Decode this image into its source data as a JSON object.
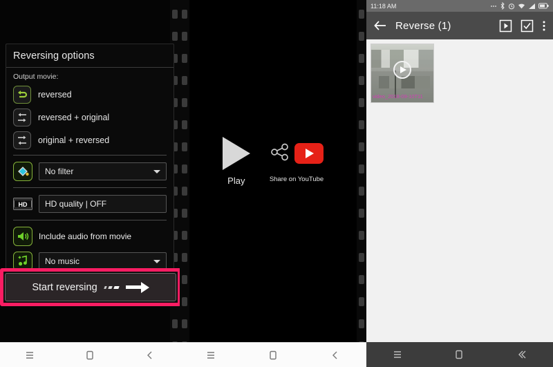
{
  "panel1": {
    "card_title": "Reversing options",
    "sub_label": "Output movie:",
    "options": [
      {
        "label": "reversed",
        "icon": "reverse-loop-icon",
        "selected": true
      },
      {
        "label": "reversed + original",
        "icon": "reverse-then-forward-icon",
        "selected": false
      },
      {
        "label": "original + reversed",
        "icon": "forward-then-reverse-icon",
        "selected": false
      }
    ],
    "filter": {
      "icon": "paint-bucket-icon",
      "value": "No filter"
    },
    "hd": {
      "icon": "hd-film-icon",
      "label": "HD quality | OFF"
    },
    "audio": {
      "icon": "speaker-icon",
      "label": "Include audio from movie"
    },
    "music": {
      "icon": "music-note-icon",
      "value": "No music"
    },
    "start_button": "Start reversing",
    "highlight_color": "#fb1d63"
  },
  "panel2": {
    "play_label": "Play",
    "share_label": "Share on YouTube",
    "play_icon": "play-triangle-icon",
    "share_icon": "share-nodes-icon",
    "youtube_icon": "youtube-icon"
  },
  "panel3": {
    "statusbar": {
      "time": "11:18 AM",
      "icons": [
        "dots-icon",
        "bluetooth-icon",
        "alarm-icon",
        "wifi-icon",
        "signal-icon",
        "battery-icon"
      ]
    },
    "appbar": {
      "back_icon": "back-arrow-icon",
      "title": "Reverse (1)",
      "actions": [
        "play-box-icon",
        "select-checkbox-icon",
        "overflow-menu-icon"
      ]
    },
    "gallery": {
      "items": [
        {
          "filename": "video_2018-09-10T11",
          "play_overlay": "play-circle-icon",
          "filename_color": "#d13fb5"
        }
      ]
    }
  },
  "navbars": [
    {
      "theme": "light",
      "items": [
        "recents-icon",
        "home-icon",
        "back-icon"
      ]
    },
    {
      "theme": "light",
      "items": [
        "recents-icon",
        "home-icon",
        "back-icon"
      ]
    },
    {
      "theme": "dark",
      "items": [
        "recents-icon",
        "home-icon",
        "back-icon"
      ]
    }
  ]
}
